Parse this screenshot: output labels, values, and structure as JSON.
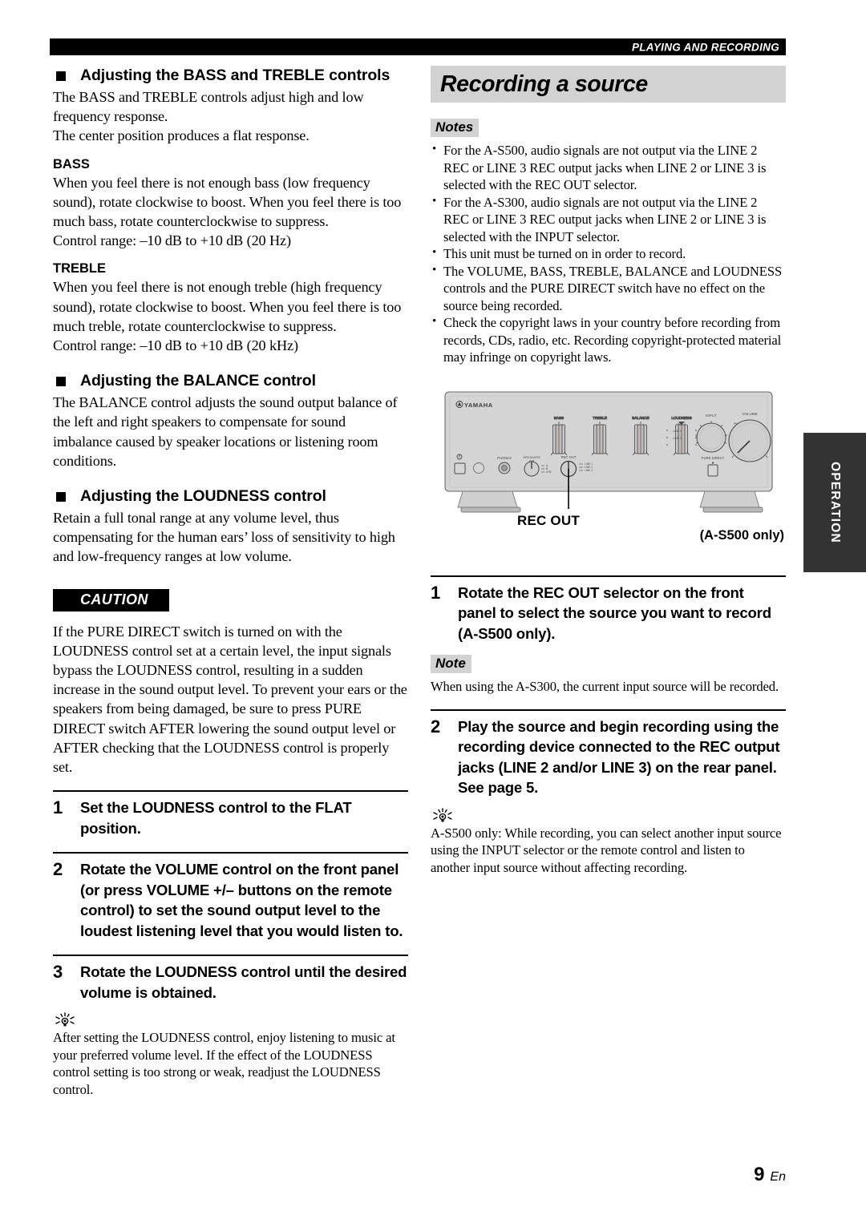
{
  "header": {
    "title": "PLAYING AND RECORDING"
  },
  "left_column": {
    "bass_treble": {
      "heading": "Adjusting the BASS and TREBLE controls",
      "intro_line1": "The BASS and TREBLE controls adjust high and low frequency response.",
      "intro_line2": "The center position produces a flat response.",
      "bass_label": "BASS",
      "bass_body": "When you feel there is not enough bass (low frequency sound), rotate clockwise to boost. When you feel there is too much bass, rotate counterclockwise to suppress.",
      "bass_range": "Control range: –10 dB to +10 dB (20 Hz)",
      "treble_label": "TREBLE",
      "treble_body": "When you feel there is not enough treble (high frequency sound), rotate clockwise to boost. When you feel there is too much treble, rotate counterclockwise to suppress.",
      "treble_range": "Control range: –10 dB to +10 dB (20 kHz)"
    },
    "balance": {
      "heading": "Adjusting the BALANCE control",
      "body": "The BALANCE control adjusts the sound output balance of the left and right speakers to compensate for sound imbalance caused by speaker locations or listening room conditions."
    },
    "loudness": {
      "heading": "Adjusting the LOUDNESS control",
      "body": "Retain a full tonal range at any volume level, thus compensating for the human ears’ loss of sensitivity to high and low-frequency ranges at low volume."
    },
    "caution": {
      "label": "CAUTION",
      "body": "If the PURE DIRECT switch is turned on with the LOUDNESS control set at a certain level, the input signals bypass the LOUDNESS control, resulting in a sudden increase in the sound output level. To prevent your ears or the speakers from being damaged, be sure to press PURE DIRECT switch AFTER lowering the sound output level or AFTER checking that the LOUDNESS control is properly set."
    },
    "steps": [
      {
        "num": "1",
        "text": "Set the LOUDNESS control to the FLAT position."
      },
      {
        "num": "2",
        "text": "Rotate the VOLUME control on the front panel (or press VOLUME +/– buttons on the remote control) to set the sound output level to the loudest listening level that you would listen to."
      },
      {
        "num": "3",
        "text": "Rotate the LOUDNESS control until the desired volume is obtained."
      }
    ],
    "tip": "After setting the LOUDNESS control, enjoy listening to music at your preferred volume level. If the effect of the LOUDNESS control setting is too strong or weak, readjust the LOUDNESS control."
  },
  "right_column": {
    "section_title": "Recording a source",
    "notes_label": "Notes",
    "notes": [
      "For the A-S500, audio signals are not output via the LINE 2 REC or LINE 3 REC output jacks when LINE 2 or LINE 3 is selected with the REC OUT selector.",
      "For the A-S300, audio signals are not output via the LINE 2 REC or LINE 3 REC output jacks when LINE 2 or LINE 3 is selected with the INPUT selector.",
      "This unit must be turned on in order to record.",
      "The VOLUME, BASS, TREBLE, BALANCE and LOUDNESS controls and the PURE DIRECT switch have no effect on the source being recorded.",
      "Check the copyright laws in your country before recording from records, CDs, radio, etc. Recording copyright-protected material may infringe on copyright laws."
    ],
    "figure": {
      "brand": "YAMAHA",
      "callout_label": "REC OUT",
      "model_note": "(A-S500 only)",
      "panel_labels": {
        "bass": "BASS",
        "treble": "TREBLE",
        "balance": "BALANCE",
        "loudness": "LOUDNESS",
        "input": "INPUT",
        "volume": "VOLUME",
        "phones": "PHONES",
        "speakers": "SPEAKERS A/B",
        "rec_out": "REC OUT",
        "pure_direct": "PURE DIRECT"
      }
    },
    "step1": {
      "num": "1",
      "text": "Rotate the REC OUT selector on the front panel to select the source you want to record (A-S500 only)."
    },
    "note_label": "Note",
    "note_body": "When using the A-S300, the current input source will be recorded.",
    "step2": {
      "num": "2",
      "text": "Play the source and begin recording using the recording device connected to the REC output jacks (LINE 2 and/or LINE 3) on the rear panel. See page 5."
    },
    "tip": "A-S500 only: While recording, you can select another input source using the INPUT selector or the remote control and listen to another input source without affecting recording."
  },
  "side_tab": {
    "label": "OPERATION"
  },
  "footer": {
    "page_number": "9",
    "language": "En"
  }
}
